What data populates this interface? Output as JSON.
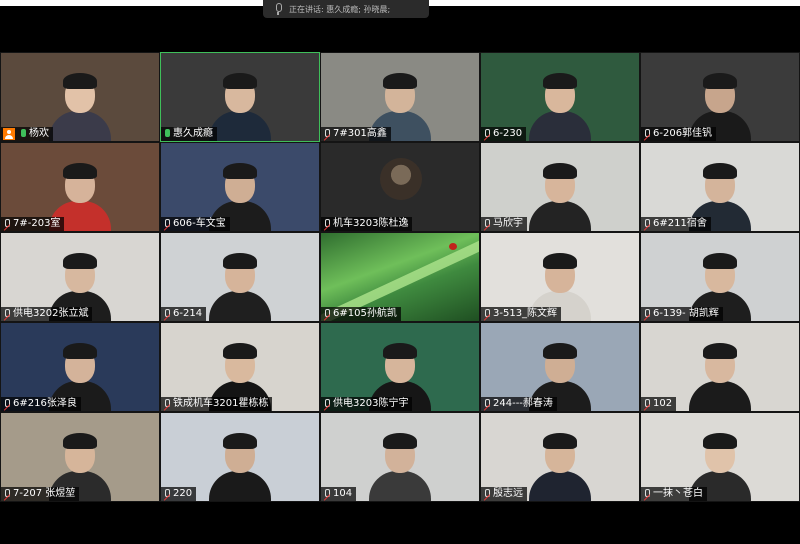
{
  "speaking_bar": {
    "text": "正在讲话: 惠久成瘾; 孙晓晨;"
  },
  "tiles": [
    {
      "name": "杨欢",
      "mic": "host",
      "bg": "#5b4a3d",
      "shirt": "#3b3b4a",
      "skin": "#e2c2a8"
    },
    {
      "name": "惠久成瘾",
      "mic": "on",
      "bg": "#3a3a3a",
      "shirt": "#1e2a3a",
      "skin": "#d8b89e",
      "active": true
    },
    {
      "name": "7#301高鑫",
      "mic": "off",
      "bg": "#8a8a84",
      "shirt": "#3e5060",
      "skin": "#d3b49a"
    },
    {
      "name": "6-230",
      "mic": "off",
      "bg": "#2f5a3e",
      "shirt": "#2a2e3a",
      "skin": "#d9b79c"
    },
    {
      "name": "6-206郭佳钒",
      "mic": "off",
      "bg": "#3b3b3b",
      "shirt": "#1a1a1a",
      "skin": "#c7a58c"
    },
    {
      "name": "7#-203室",
      "mic": "off",
      "bg": "#6b4b3a",
      "shirt": "#c4302b",
      "skin": "#d6b39a"
    },
    {
      "name": "606-车文宝",
      "mic": "off",
      "bg": "#3b4a6a",
      "shirt": "#1c1c1c",
      "skin": "#cfae94"
    },
    {
      "name": "机车3203陈杜逸",
      "mic": "off",
      "bg": "#2a2a2a",
      "avatar": true
    },
    {
      "name": "马欣宇",
      "mic": "off",
      "bg": "#cfd0cc",
      "shirt": "#232323",
      "skin": "#d7b59b"
    },
    {
      "name": "6#211宿舍",
      "mic": "off",
      "bg": "#d9d9d6",
      "shirt": "#222a34",
      "skin": "#d4b49b"
    },
    {
      "name": "供电3202张立斌",
      "mic": "off",
      "bg": "#d8d6d2",
      "shirt": "#1d1d1d",
      "skin": "#d7b89f"
    },
    {
      "name": "6-214",
      "mic": "off",
      "bg": "#cfd2d4",
      "shirt": "#1f1f1f",
      "skin": "#d6b49a"
    },
    {
      "name": "6#105孙航凯",
      "mic": "off",
      "bg": "#3f8a3f",
      "grass": true
    },
    {
      "name": "3-513_陈文辉",
      "mic": "off",
      "bg": "#e2e0dc",
      "shirt": "#d5d2cc",
      "skin": "#d6b49a"
    },
    {
      "name": "6-139- 胡凯辉",
      "mic": "off",
      "bg": "#cfd1d2",
      "shirt": "#1e1e1e",
      "skin": "#d8b89e"
    },
    {
      "name": "6#216张泽良",
      "mic": "off",
      "bg": "#2a3a5a",
      "shirt": "#1b1b1b",
      "skin": "#d4b39a"
    },
    {
      "name": "铁成机车3201瞿栋栋",
      "mic": "off",
      "bg": "#d7d4ce",
      "shirt": "#141414",
      "skin": "#d9b99e"
    },
    {
      "name": "供电3203陈宁宇",
      "mic": "off",
      "bg": "#2e6a4e",
      "shirt": "#161616",
      "skin": "#d6b59b"
    },
    {
      "name": "244---郝春涛",
      "mic": "off",
      "bg": "#9aa7b6",
      "shirt": "#1c1c1c",
      "skin": "#cfae94"
    },
    {
      "name": "102",
      "mic": "off",
      "bg": "#d8d6d1",
      "shirt": "#1b1b1b",
      "skin": "#d8b89f"
    },
    {
      "name": "7-207 张煜堃",
      "mic": "off",
      "bg": "#a59b8a",
      "shirt": "#2b2b2b",
      "skin": "#d6b59a"
    },
    {
      "name": "220",
      "mic": "off",
      "bg": "#c9cfd6",
      "shirt": "#1a1a1a",
      "skin": "#cfae94"
    },
    {
      "name": "104",
      "mic": "off",
      "bg": "#cfd0cf",
      "shirt": "#3a3a3a",
      "skin": "#d2b29a"
    },
    {
      "name": "殷志远",
      "mic": "off",
      "bg": "#d8d6d2",
      "shirt": "#1f2430",
      "skin": "#d6b59a"
    },
    {
      "name": "一抹丶苍白",
      "mic": "off",
      "bg": "#dcdad6",
      "shirt": "#2a2a2a",
      "skin": "#e0c3aa"
    }
  ]
}
